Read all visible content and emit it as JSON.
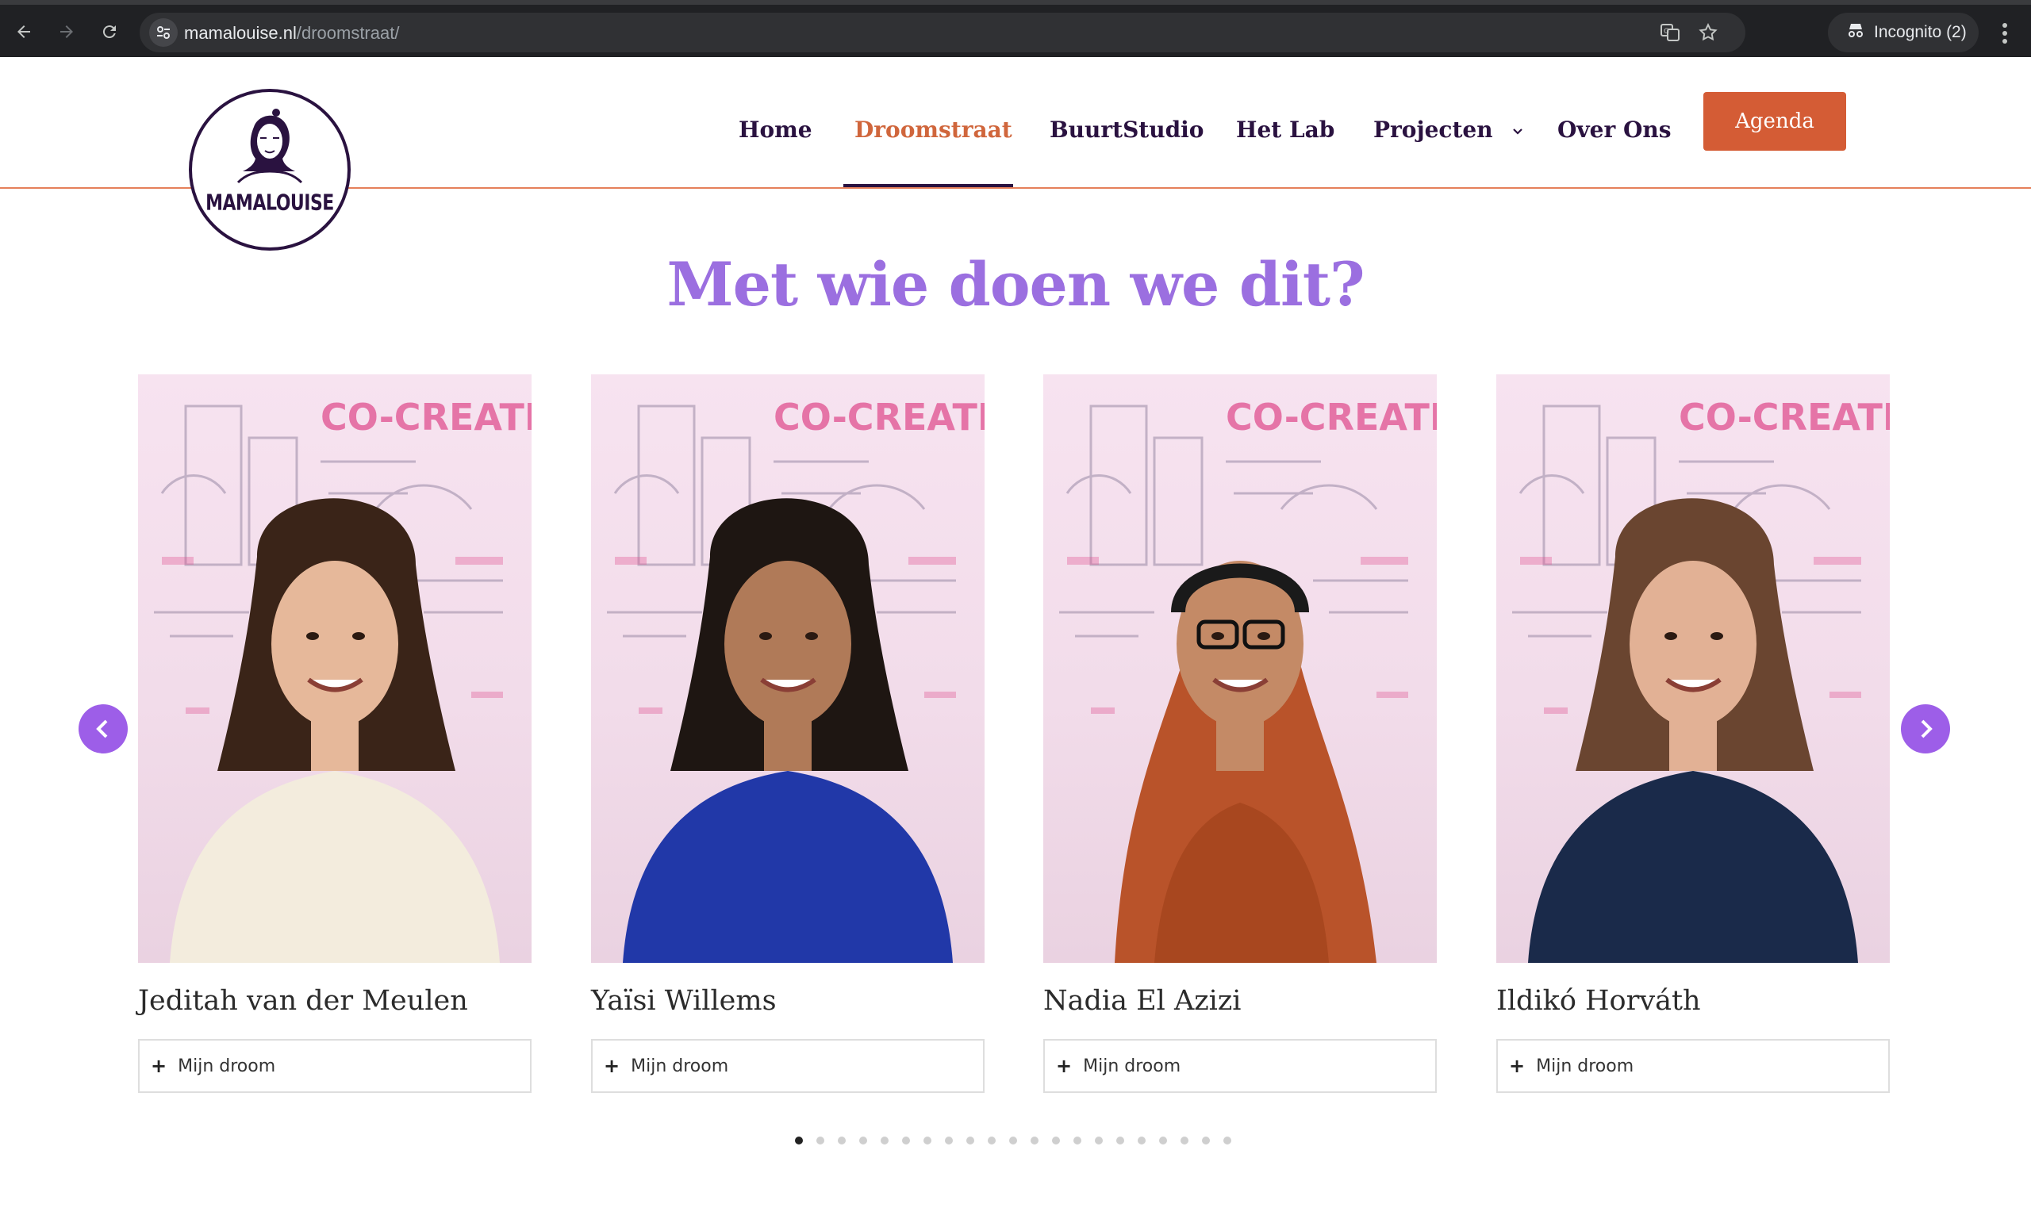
{
  "browser": {
    "url_host": "mamalouise.nl",
    "url_path": "/droomstraat/",
    "incognito_label": "Incognito (2)"
  },
  "site": {
    "logo_text": "MAMALOUISE",
    "nav": [
      {
        "label": "Home",
        "active": false
      },
      {
        "label": "Droomstraat",
        "active": true
      },
      {
        "label": "BuurtStudio",
        "active": false
      },
      {
        "label": "Het Lab",
        "active": false
      },
      {
        "label": "Projecten",
        "active": false,
        "dropdown": true
      },
      {
        "label": "Over Ons",
        "active": false
      }
    ],
    "cta_label": "Agenda",
    "colors": {
      "brand_dark": "#2a1240",
      "accent_orange": "#d45c35",
      "title_purple": "#9b6fe0",
      "arrow_purple": "#9d5ee8"
    }
  },
  "section": {
    "title": "Met wie doen we dit?"
  },
  "people": [
    {
      "name": "Jeditah van der Meulen",
      "toggle_label": "Mijn droom",
      "sweater": "#f3ecdd",
      "hair": "#3a2418",
      "skin": "#e6b89a"
    },
    {
      "name": "Yaïsi Willems",
      "toggle_label": "Mijn droom",
      "sweater": "#2138a8",
      "hair": "#1e1612",
      "skin": "#b07a58"
    },
    {
      "name": "Nadia El Azizi",
      "toggle_label": "Mijn droom",
      "sweater": "#b9532a",
      "hair": "#b9532a",
      "skin": "#c48a66"
    },
    {
      "name": "Ildikó Horváth",
      "toggle_label": "Mijn droom",
      "sweater": "#1a2a4a",
      "hair": "#6a4530",
      "skin": "#e2b195"
    }
  ],
  "carousel": {
    "dot_count": 21,
    "active_index": 0
  }
}
